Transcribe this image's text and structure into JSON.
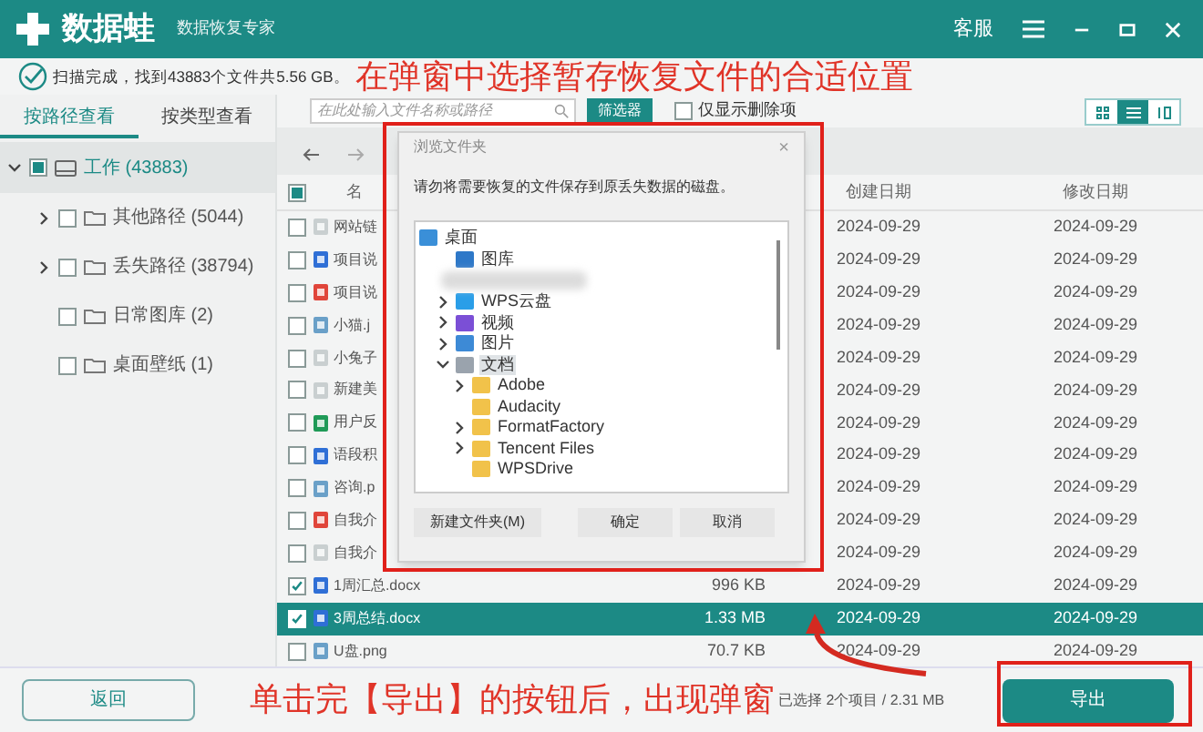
{
  "app": {
    "name": "数据蛙",
    "subtitle": "数据恢复专家",
    "support": "客服"
  },
  "scan_status": "扫描完成，找到43883个文件共5.56 GB。",
  "annotation_top": "在弹窗中选择暂存恢复文件的合适位置",
  "annotation_bottom": "单击完【导出】的按钮后，出现弹窗",
  "view_tabs": [
    {
      "label": "按路径查看",
      "selected": true
    },
    {
      "label": "按类型查看",
      "selected": false
    }
  ],
  "tree": [
    {
      "label": "工作 (43883)",
      "expanded": true,
      "checked": false,
      "indeterminate": true,
      "selected": true,
      "kind": "drive",
      "children": [
        {
          "label": "其他路径 (5044)",
          "expanded": false,
          "checked": false,
          "selected": false,
          "kind": "folder"
        },
        {
          "label": "丢失路径 (38794)",
          "expanded": false,
          "checked": false,
          "selected": false,
          "kind": "folder"
        },
        {
          "label": "日常图库 (2)",
          "checked": false,
          "selected": false,
          "kind": "folder"
        },
        {
          "label": "桌面壁纸 (1)",
          "checked": false,
          "selected": false,
          "kind": "folder"
        }
      ]
    }
  ],
  "search": {
    "placeholder": "在此处输入文件名称或路径"
  },
  "filter_button": "筛选器",
  "deleted_only": {
    "label": "仅显示删除项",
    "checked": false
  },
  "view_modes": [
    {
      "kind": "grid",
      "selected": false
    },
    {
      "kind": "list",
      "selected": true
    },
    {
      "kind": "detail",
      "selected": false
    }
  ],
  "table": {
    "columns": [
      "名",
      "创建日期",
      "修改日期"
    ],
    "select_all": {
      "checked": false,
      "indeterminate": true
    },
    "rows": [
      {
        "name": "网站链",
        "kind": "txt",
        "created": "2024-09-29",
        "modified": "2024-09-29",
        "checked": false,
        "selected": false
      },
      {
        "name": "项目说",
        "kind": "doc",
        "created": "2024-09-29",
        "modified": "2024-09-29",
        "checked": false,
        "selected": false
      },
      {
        "name": "项目说",
        "kind": "pdf",
        "created": "2024-09-29",
        "modified": "2024-09-29",
        "checked": false,
        "selected": false
      },
      {
        "name": "小猫.j",
        "kind": "img",
        "created": "2024-09-29",
        "modified": "2024-09-29",
        "checked": false,
        "selected": false
      },
      {
        "name": "小兔子",
        "kind": "txt",
        "created": "2024-09-29",
        "modified": "2024-09-29",
        "checked": false,
        "selected": false
      },
      {
        "name": "新建美",
        "kind": "txt",
        "created": "2024-09-29",
        "modified": "2024-09-29",
        "checked": false,
        "selected": false
      },
      {
        "name": "用户反",
        "kind": "xls",
        "created": "2024-09-29",
        "modified": "2024-09-29",
        "checked": false,
        "selected": false
      },
      {
        "name": "语段积",
        "kind": "doc",
        "created": "2024-09-29",
        "modified": "2024-09-29",
        "checked": false,
        "selected": false
      },
      {
        "name": "咨询.p",
        "kind": "img",
        "created": "2024-09-29",
        "modified": "2024-09-29",
        "checked": false,
        "selected": false
      },
      {
        "name": "自我介",
        "kind": "pdf",
        "created": "2024-09-29",
        "modified": "2024-09-29",
        "checked": false,
        "selected": false
      },
      {
        "name": "自我介",
        "kind": "txt",
        "created": "2024-09-29",
        "modified": "2024-09-29",
        "checked": false,
        "selected": false
      },
      {
        "name": "1周汇总.docx",
        "kind": "doc",
        "size": "996 KB",
        "created": "2024-09-29",
        "modified": "2024-09-29",
        "checked": true,
        "selected": false
      },
      {
        "name": "3周总结.docx",
        "kind": "doc",
        "size": "1.33 MB",
        "created": "2024-09-29",
        "modified": "2024-09-29",
        "checked": true,
        "selected": true
      },
      {
        "name": "U盘.png",
        "kind": "img",
        "size": "70.7 KB",
        "created": "2024-09-29",
        "modified": "2024-09-29",
        "checked": false,
        "selected": false
      }
    ]
  },
  "dialog": {
    "title": "浏览文件夹",
    "close": "×",
    "prompt": "请勿将需要恢复的文件保存到原丢失数据的磁盘。",
    "tree": [
      {
        "label": "桌面",
        "kind": "desktop",
        "selected": false,
        "children": [
          {
            "label": "图库",
            "kind": "gallery",
            "selected": false
          },
          {
            "kind": "blurred"
          },
          {
            "label": "WPS云盘",
            "kind": "cloud",
            "expanded": false,
            "selected": false
          },
          {
            "label": "视频",
            "kind": "video",
            "expanded": false,
            "selected": false
          },
          {
            "label": "图片",
            "kind": "picture",
            "expanded": false,
            "selected": false
          },
          {
            "label": "文档",
            "kind": "docs",
            "expanded": true,
            "selected": true,
            "children": [
              {
                "label": "Adobe",
                "kind": "folder",
                "expanded": false,
                "selected": false
              },
              {
                "label": "Audacity",
                "kind": "folder",
                "selected": false
              },
              {
                "label": "FormatFactory",
                "kind": "folder",
                "expanded": false,
                "selected": false
              },
              {
                "label": "Tencent Files",
                "kind": "folder",
                "expanded": false,
                "selected": false
              },
              {
                "label": "WPSDrive",
                "kind": "folder",
                "selected": false
              }
            ]
          }
        ]
      }
    ],
    "buttons": [
      "新建文件夹(M)",
      "确定",
      "取消"
    ]
  },
  "footer": {
    "back": "返回",
    "selection": "已选择 2个项目 / 2.31 MB",
    "export": "导出"
  }
}
